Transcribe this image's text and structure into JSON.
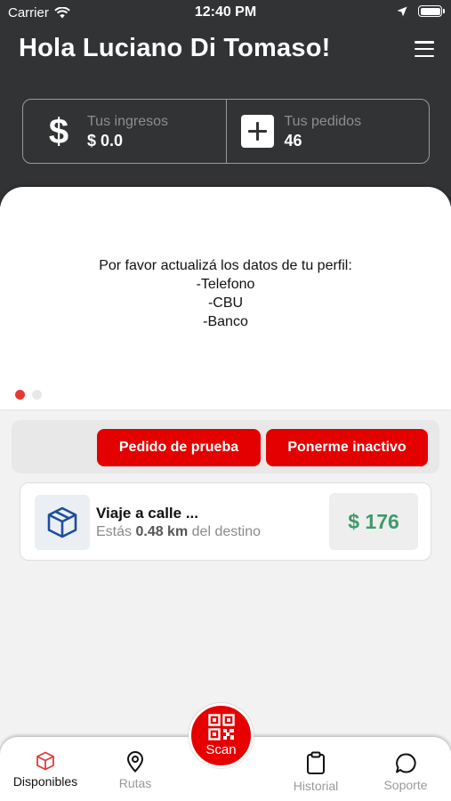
{
  "status_bar": {
    "carrier": "Carrier",
    "time": "12:40 PM"
  },
  "header": {
    "greeting": "Hola Luciano Di Tomaso!"
  },
  "stats": {
    "income_label": "Tus ingresos",
    "income_value": "$ 0.0",
    "income_icon": "$",
    "orders_label": "Tus pedidos",
    "orders_value": "46"
  },
  "carousel": {
    "message_lines": [
      "Por favor actualizá los datos de tu perfil:",
      "-Telefono",
      "-CBU",
      "-Banco"
    ],
    "active_slide": 1,
    "slide_count": 2
  },
  "actions": {
    "test_order_label": "Pedido de prueba",
    "inactive_label": "Ponerme inactivo"
  },
  "order": {
    "title": "Viaje a calle ...",
    "distance_prefix": "Estás",
    "distance_value": "0.48 km",
    "distance_suffix": "del destino",
    "price": "$ 176"
  },
  "tabs": {
    "available": "Disponibles",
    "routes": "Rutas",
    "scan": "Scan",
    "history": "Historial",
    "support": "Soporte"
  },
  "colors": {
    "header_bg": "#323334",
    "accent_red": "#e50000",
    "price_green": "#3e9a6b",
    "icon_blue": "#1d4e9e"
  }
}
